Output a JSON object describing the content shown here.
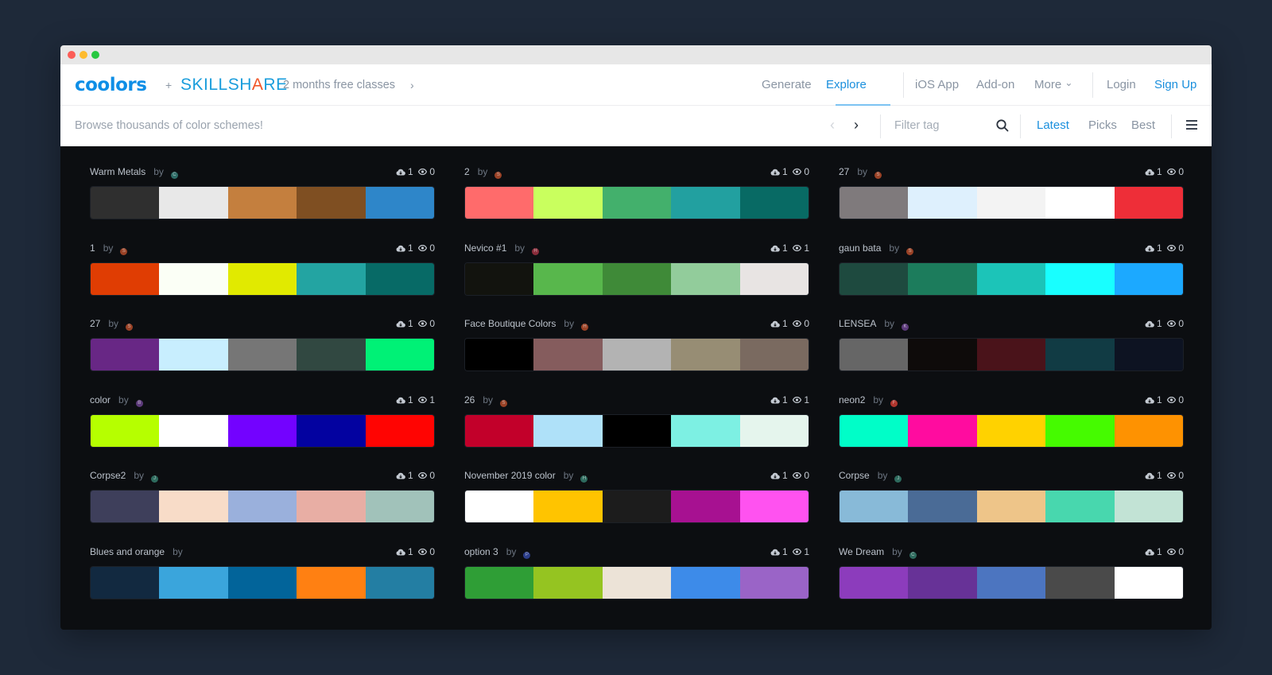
{
  "nav": {
    "logo": "coolors",
    "plus": "+",
    "partner_parts": [
      "SKILL",
      "SH",
      "A",
      "RE"
    ],
    "promo": "2 months free classes",
    "promo_chevron": "›",
    "items": [
      "Generate",
      "Explore",
      "iOS App",
      "Add-on",
      "More"
    ],
    "more_chevron": "⌄",
    "login": "Login",
    "signup": "Sign Up"
  },
  "subbar": {
    "browse_text": "Browse thousands of color schemes!",
    "prev_arrow": "‹",
    "next_arrow": "›",
    "filter_placeholder": "Filter tag",
    "sort": [
      "Latest",
      "Picks",
      "Best"
    ]
  },
  "by_label": "by",
  "palettes": [
    {
      "name": "Warm Metals",
      "avatar": "C",
      "avatar_color": "#2e6b66",
      "saves": "1",
      "views": "0",
      "colors": [
        "#2f2f2f",
        "#e8e8e8",
        "#c47f3e",
        "#7f4f22",
        "#2e86c9"
      ]
    },
    {
      "name": "2",
      "avatar": "S",
      "avatar_color": "#9a4226",
      "saves": "1",
      "views": "0",
      "colors": [
        "#ff6b6b",
        "#c9ff5e",
        "#43b06c",
        "#22a0a0",
        "#086a64"
      ]
    },
    {
      "name": "27",
      "avatar": "S",
      "avatar_color": "#9a4226",
      "saves": "1",
      "views": "0",
      "colors": [
        "#7f7a7c",
        "#def0fd",
        "#f3f3f3",
        "#ffffff",
        "#ee2e38"
      ]
    },
    {
      "name": "1",
      "avatar": "S",
      "avatar_color": "#9a4226",
      "saves": "1",
      "views": "0",
      "colors": [
        "#e03d03",
        "#fbfff6",
        "#e1ea00",
        "#23a4a2",
        "#076a66"
      ]
    },
    {
      "name": "Nevico #1",
      "avatar": "H",
      "avatar_color": "#8a2c3a",
      "saves": "1",
      "views": "1",
      "colors": [
        "#12130e",
        "#58b74c",
        "#3f8a38",
        "#92cc9b",
        "#e8e4e3"
      ]
    },
    {
      "name": "gaun bata",
      "avatar": "S",
      "avatar_color": "#9a4226",
      "saves": "1",
      "views": "0",
      "colors": [
        "#1e4a3f",
        "#1c7c5c",
        "#1cc4b8",
        "#18ffff",
        "#1ca9ff"
      ]
    },
    {
      "name": "27",
      "avatar": "S",
      "avatar_color": "#9a4226",
      "saves": "1",
      "views": "0",
      "colors": [
        "#682785",
        "#c8eefe",
        "#767676",
        "#314841",
        "#00f176"
      ]
    },
    {
      "name": "Face Boutique Colors",
      "avatar": "H",
      "avatar_color": "#9a4226",
      "saves": "1",
      "views": "0",
      "colors": [
        "#000000",
        "#855c5d",
        "#b3b3b3",
        "#978d74",
        "#7a6a60"
      ]
    },
    {
      "name": "LENSEA",
      "avatar": "K",
      "avatar_color": "#5c3a7a",
      "saves": "1",
      "views": "0",
      "colors": [
        "#666666",
        "#0e0b0a",
        "#4a131a",
        "#113b44",
        "#0d1322"
      ]
    },
    {
      "name": "color",
      "avatar": "B",
      "avatar_color": "#5c3a7a",
      "saves": "1",
      "views": "1",
      "colors": [
        "#b6ff00",
        "#ffffff",
        "#7302ff",
        "#0302a0",
        "#ff0402"
      ]
    },
    {
      "name": "26",
      "avatar": "S",
      "avatar_color": "#9a4226",
      "saves": "1",
      "views": "1",
      "colors": [
        "#c2002a",
        "#afe1f9",
        "#000000",
        "#7df0e3",
        "#e5f5ed"
      ]
    },
    {
      "name": "neon2",
      "avatar": "F",
      "avatar_color": "#b0362e",
      "saves": "1",
      "views": "0",
      "colors": [
        "#00fec8",
        "#ff0c9f",
        "#ffd200",
        "#45fb00",
        "#fe9201"
      ]
    },
    {
      "name": "Corpse2",
      "avatar": "J",
      "avatar_color": "#2e6b5e",
      "saves": "1",
      "views": "0",
      "colors": [
        "#3e3f5b",
        "#f8dcc8",
        "#9ab0dc",
        "#e8aea4",
        "#a1c2ba"
      ]
    },
    {
      "name": "November 2019 color",
      "avatar": "H",
      "avatar_color": "#2e6b5e",
      "saves": "1",
      "views": "0",
      "colors": [
        "#ffffff",
        "#ffc400",
        "#1c1c1c",
        "#a71191",
        "#ff52f0"
      ]
    },
    {
      "name": "Corpse",
      "avatar": "J",
      "avatar_color": "#2e6b5e",
      "saves": "1",
      "views": "0",
      "colors": [
        "#88bad8",
        "#4a6b96",
        "#eec589",
        "#48d7ae",
        "#c2e3d5"
      ]
    },
    {
      "name": "Blues and orange",
      "avatar": "",
      "avatar_color": "",
      "saves": "1",
      "views": "0",
      "colors": [
        "#122940",
        "#3aa5dc",
        "#02649a",
        "#ff8012",
        "#237ea3"
      ]
    },
    {
      "name": "option 3",
      "avatar": "P",
      "avatar_color": "#2c3e8a",
      "saves": "1",
      "views": "1",
      "colors": [
        "#2f9e36",
        "#95c421",
        "#ece3d7",
        "#3d8be9",
        "#9a64c7"
      ]
    },
    {
      "name": "We Dream",
      "avatar": "C",
      "avatar_color": "#2e6b5e",
      "saves": "1",
      "views": "0",
      "colors": [
        "#8c3cbc",
        "#673297",
        "#4c75c0",
        "#4a4a4a",
        "#ffffff"
      ]
    }
  ]
}
